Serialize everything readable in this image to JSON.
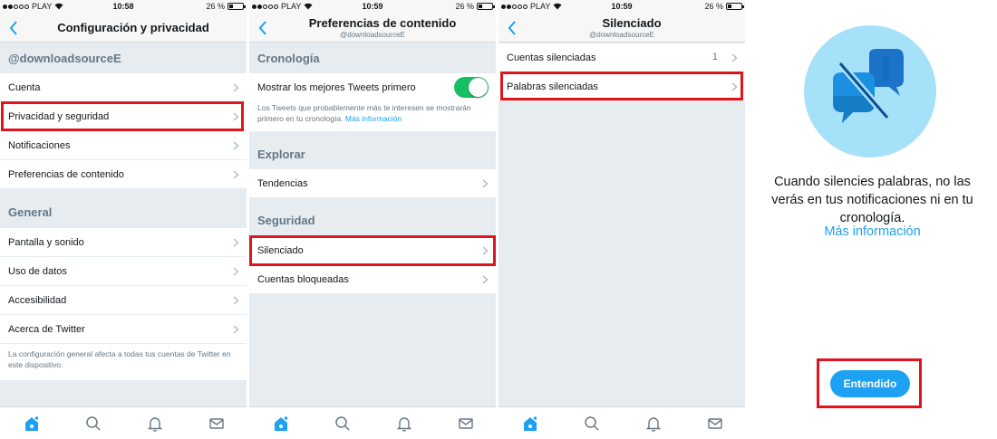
{
  "status_bars": [
    {
      "carrier": "PLAY",
      "time": "10:58",
      "battery": "26 %"
    },
    {
      "carrier": "PLAY",
      "time": "10:59",
      "battery": "26 %"
    },
    {
      "carrier": "PLAY",
      "time": "10:59",
      "battery": "26 %"
    }
  ],
  "screen1": {
    "title": "Configuración y privacidad",
    "account_header": "@downloadsourceE",
    "account_items": [
      "Cuenta",
      "Privacidad y seguridad",
      "Notificaciones",
      "Preferencias de contenido"
    ],
    "general_header": "General",
    "general_items": [
      "Pantalla y sonido",
      "Uso de datos",
      "Accesibilidad",
      "Acerca de Twitter"
    ],
    "note": "La configuración general afecta a todas tus cuentas de Twitter en este dispositivo."
  },
  "screen2": {
    "title": "Preferencias de contenido",
    "subtitle": "@downloadsourceE",
    "timeline_header": "Cronología",
    "best_tweets_label": "Mostrar los mejores Tweets primero",
    "best_tweets_on": true,
    "best_tweets_note": "Los Tweets que probablemente más te interesen se mostrarán primero en tu cronología.",
    "more_info": "Más información",
    "explore_header": "Explorar",
    "trends_label": "Tendencias",
    "safety_header": "Seguridad",
    "muted_label": "Silenciado",
    "blocked_label": "Cuentas bloqueadas"
  },
  "screen3": {
    "title": "Silenciado",
    "subtitle": "@downloadsourceE",
    "muted_accounts_label": "Cuentas silenciadas",
    "muted_accounts_count": "1",
    "muted_words_label": "Palabras silenciadas"
  },
  "screen4": {
    "message": "Cuando silencies palabras, no las verás en tus notificaciones ni en tu cronología.",
    "more_info": "Más información",
    "button": "Entendido"
  },
  "colors": {
    "accent": "#1da1f2",
    "highlight_box": "#e0141e",
    "toggle_on": "#17bf63",
    "background": "#e6ecf0"
  },
  "icons": [
    "back-chevron-icon",
    "chevron-right-icon",
    "home-icon",
    "search-icon",
    "notifications-bell-icon",
    "messages-envelope-icon",
    "wifi-icon",
    "battery-icon",
    "muted-chat-bubbles-icon"
  ]
}
